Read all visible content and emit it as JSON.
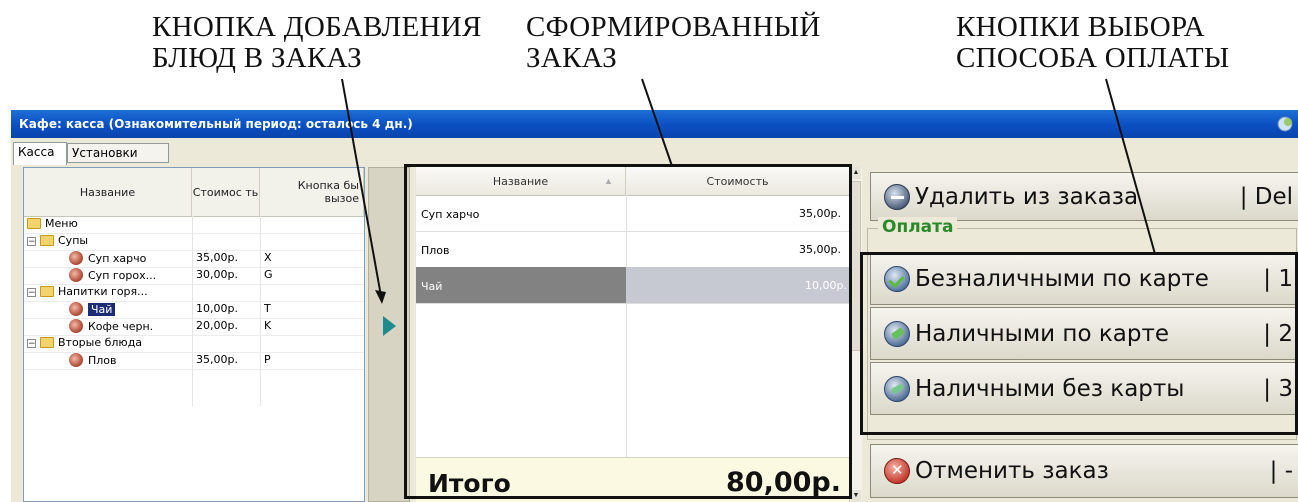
{
  "captions": {
    "add_button": [
      "КНОПКА ДОБАВЛЕНИЯ",
      "БЛЮД В ЗАКАЗ"
    ],
    "formed_order": [
      "СФОРМИРОВАННЫЙ",
      "ЗАКАЗ"
    ],
    "payment_buttons": [
      "КНОПКИ ВЫБОРА",
      "СПОСОБА ОПЛАТЫ"
    ]
  },
  "window": {
    "title": "Кафе: касса (Ознакомительный период: осталось 4 дн.)"
  },
  "tabs": [
    {
      "label": "Касса",
      "active": true
    },
    {
      "label": "Установки",
      "active": false
    }
  ],
  "menu_tree": {
    "headers": [
      "Название",
      "Стоимос ть",
      "Кнопка бы вызое"
    ],
    "rows": [
      {
        "name": "Меню",
        "price": "",
        "key": "",
        "kind": "folder",
        "level": 0
      },
      {
        "name": "Супы",
        "price": "",
        "key": "",
        "kind": "folder",
        "level": 1
      },
      {
        "name": "Суп харчо",
        "price": "35,00р.",
        "key": "X",
        "kind": "dish",
        "level": 2
      },
      {
        "name": "Суп горох...",
        "price": "30,00р.",
        "key": "G",
        "kind": "dish",
        "level": 2
      },
      {
        "name": "Напитки горя...",
        "price": "",
        "key": "",
        "kind": "folder",
        "level": 1
      },
      {
        "name": "Чай",
        "price": "10,00р.",
        "key": "T",
        "kind": "dish",
        "level": 2,
        "selected": true
      },
      {
        "name": "Кофе черн.",
        "price": "20,00р.",
        "key": "K",
        "kind": "dish",
        "level": 2
      },
      {
        "name": "Вторые блюда",
        "price": "",
        "key": "",
        "kind": "folder",
        "level": 1
      },
      {
        "name": "Плов",
        "price": "35,00р.",
        "key": "P",
        "kind": "dish",
        "level": 2
      }
    ]
  },
  "order": {
    "headers": {
      "name": "Название",
      "price": "Стоимость"
    },
    "rows": [
      {
        "name": "Суп харчо",
        "price": "35,00р."
      },
      {
        "name": "Плов",
        "price": "35,00р."
      },
      {
        "name": "Чай",
        "price": "10,00р.",
        "selected": true
      }
    ],
    "total_label": "Итого",
    "total_value": "80,00р."
  },
  "actions": {
    "delete": {
      "label": "Удалить из заказа",
      "hotkey": "| Del"
    },
    "payment_group_label": "Оплата",
    "pay_card": {
      "label": "Безналичными по карте",
      "hotkey": "| 1"
    },
    "pay_cash_card": {
      "label": "Наличными по карте",
      "hotkey": "| 2"
    },
    "pay_cash_no_card": {
      "label": "Наличными без карты",
      "hotkey": "| 3"
    },
    "cancel": {
      "label": "Отменить заказ",
      "hotkey": "| -"
    }
  },
  "colors": {
    "titlebar": "#0a4fc2",
    "selection": "#1c2c74",
    "payment_legend": "#2a8a2a",
    "add_arrow": "#1e8c8c"
  },
  "icons": [
    "folder-icon",
    "dish-icon",
    "add-arrow-icon",
    "delete-icon",
    "card-payment-icon",
    "cash-card-icon",
    "cash-icon",
    "cancel-icon"
  ]
}
